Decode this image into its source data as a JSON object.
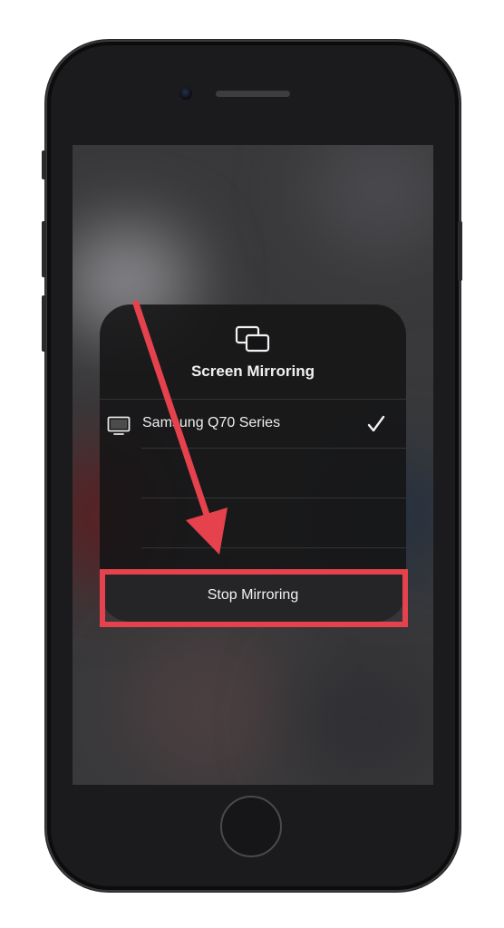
{
  "screen_mirroring": {
    "icon": "screen-mirroring-icon",
    "title": "Screen Mirroring",
    "devices": [
      {
        "label": "Samsung Q70 Series",
        "icon": "tv-icon",
        "selected": true,
        "selected_icon": "checkmark-icon"
      }
    ],
    "stop_button_label": "Stop Mirroring"
  },
  "annotation": {
    "arrow_color": "#e5424d",
    "highlight_color": "#e5424d",
    "target": "stop-mirroring-button"
  },
  "phone": {
    "frame_color": "#1b1b1d"
  }
}
